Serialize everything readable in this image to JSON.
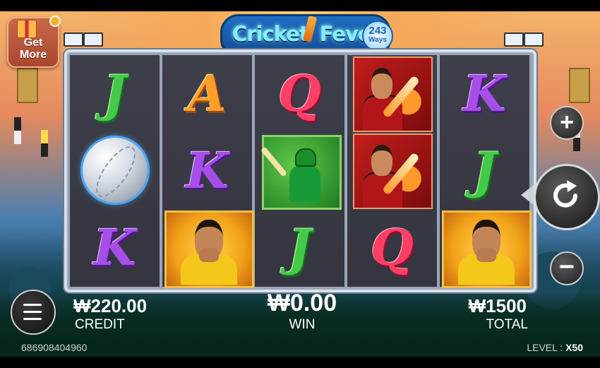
{
  "game": {
    "title_part1": "Cricket",
    "title_part2": "Fever",
    "ways_count": "243",
    "ways_label": "Ways"
  },
  "get_more": {
    "line1": "Get",
    "line2": "More"
  },
  "reels": [
    [
      {
        "type": "letter",
        "value": "J",
        "color": "#45c94a"
      },
      {
        "type": "symbol",
        "value": "cricket-ball"
      },
      {
        "type": "letter",
        "value": "K",
        "color": "#a64ee8"
      }
    ],
    [
      {
        "type": "letter",
        "value": "A",
        "color": "#ff9d2a"
      },
      {
        "type": "letter",
        "value": "K",
        "color": "#a64ee8"
      },
      {
        "type": "symbol",
        "value": "yellow-player"
      }
    ],
    [
      {
        "type": "letter",
        "value": "Q",
        "color": "#ff3f66"
      },
      {
        "type": "symbol",
        "value": "green-batsman"
      },
      {
        "type": "letter",
        "value": "J",
        "color": "#45c94a"
      }
    ],
    [
      {
        "type": "symbol",
        "value": "red-batsman"
      },
      {
        "type": "symbol",
        "value": "red-batsman"
      },
      {
        "type": "letter",
        "value": "Q",
        "color": "#ff3f66"
      }
    ],
    [
      {
        "type": "letter",
        "value": "K",
        "color": "#a64ee8"
      },
      {
        "type": "letter",
        "value": "J",
        "color": "#45c94a"
      },
      {
        "type": "symbol",
        "value": "yellow-player"
      }
    ]
  ],
  "controls": {
    "plus_icon": "plus-icon",
    "minus_icon": "minus-icon",
    "spin_icon": "refresh-icon",
    "menu_icon": "hamburger-icon",
    "plus_glyph": "+",
    "minus_glyph": "−"
  },
  "stats": {
    "credit_value": "₩220.00",
    "credit_label": "CREDIT",
    "win_value": "₩0.00",
    "win_label": "WIN",
    "total_value": "₩1500",
    "total_label": "TOTAL"
  },
  "footer": {
    "user_id": "686908404960",
    "level_label": "LEVEL :",
    "level_value": "X50"
  }
}
